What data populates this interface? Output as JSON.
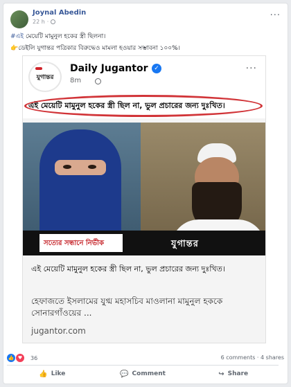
{
  "post": {
    "author": "Joynal Abedin",
    "time": "22 h",
    "hashtag": "#এই",
    "text_line1": " মেয়েটি মামুনুল হকের স্ত্রী ছিলনা।",
    "text_line2": "ডেইলি যুগান্তর পত্রিকার বিরুদ্ধেও মামলা হওয়ার সম্ভাবনা ১০০%।",
    "emoji_icon": "pointing-hand-icon"
  },
  "shared": {
    "page_name": "Daily Jugantor",
    "time": "8m",
    "logo_text": "যুগান্তর",
    "headline": "এই মেয়েটি মামুনুল হকের স্ত্রী ছিল না, ভুল প্রচারের জন্য দুঃখিত।",
    "strip_text": "সত্যের সন্ধানে নির্ভীক",
    "strip_logo": "যুগান্তর",
    "caption": "এই মেয়েটি মামুনুল হকের স্ত্রী ছিল না, ভুল প্রচারের জন্য দুঃখিত।",
    "link_title": "হেফাজতে ইসলামের যুগ্ম মহাসচিব মাওলানা মামুনুল হককে সোনারগাঁওয়ের ...",
    "domain": "jugantor.com",
    "accent": "#d13438"
  },
  "reactions": {
    "count": "36",
    "comments": "6 comments",
    "shares": "4 shares"
  },
  "actions": {
    "like": "Like",
    "comment": "Comment",
    "share": "Share"
  }
}
